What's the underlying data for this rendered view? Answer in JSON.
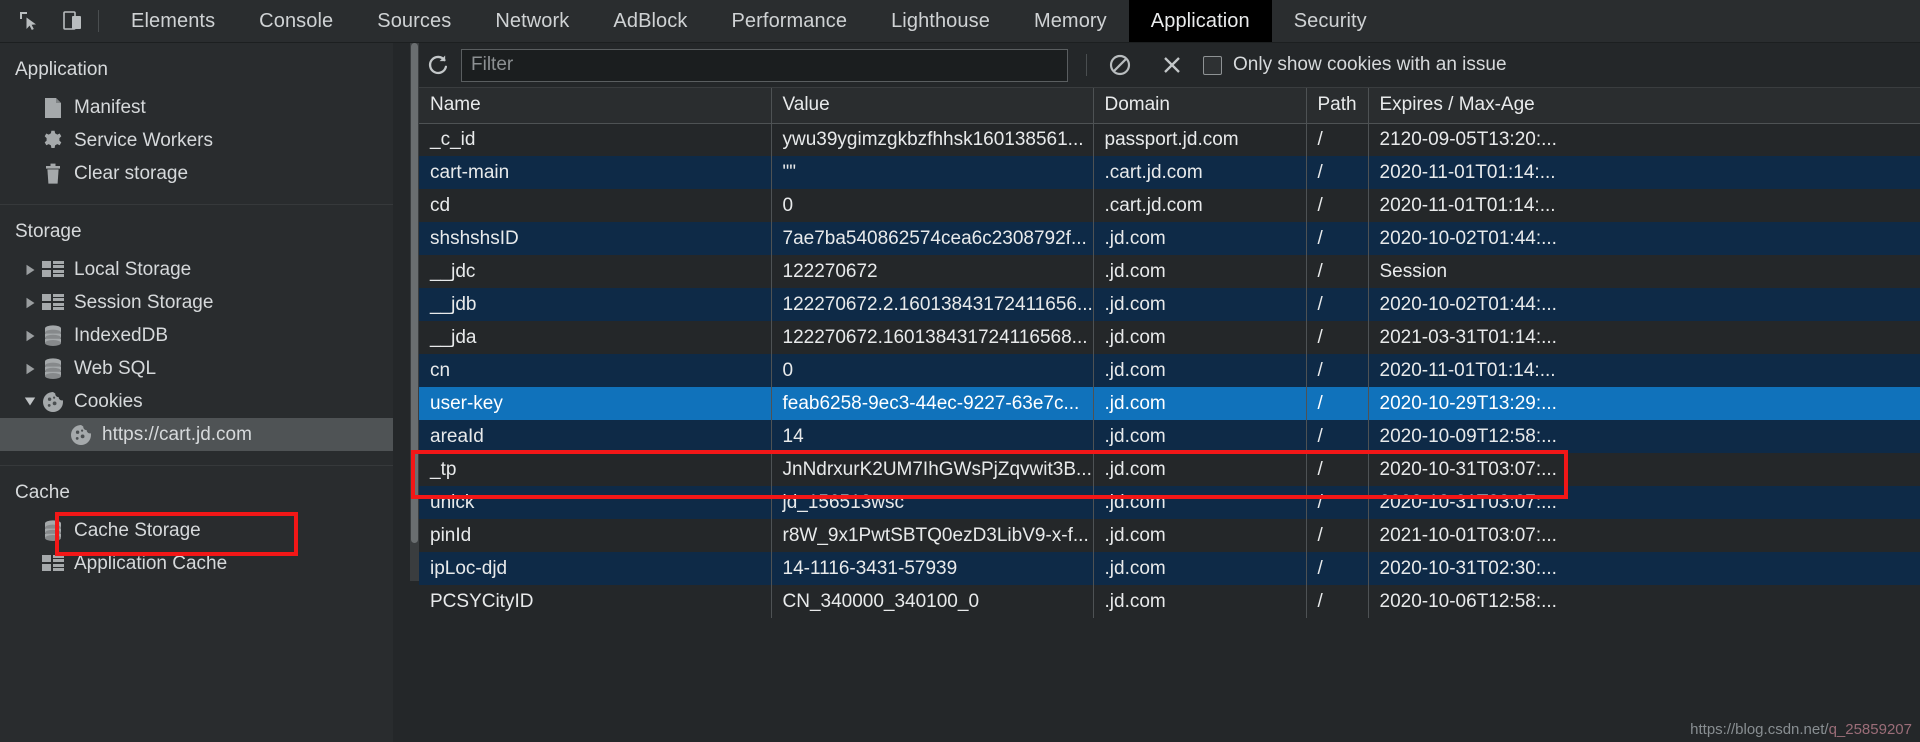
{
  "toolbar": {
    "icons": [
      {
        "name": "inspect-element-icon",
        "title": "Inspect element"
      },
      {
        "name": "device-toolbar-icon",
        "title": "Toggle device toolbar"
      }
    ],
    "tabs": [
      {
        "label": "Elements",
        "active": false
      },
      {
        "label": "Console",
        "active": false
      },
      {
        "label": "Sources",
        "active": false
      },
      {
        "label": "Network",
        "active": false
      },
      {
        "label": "AdBlock",
        "active": false
      },
      {
        "label": "Performance",
        "active": false
      },
      {
        "label": "Lighthouse",
        "active": false
      },
      {
        "label": "Memory",
        "active": false
      },
      {
        "label": "Application",
        "active": true
      },
      {
        "label": "Security",
        "active": false
      }
    ]
  },
  "sidebar": {
    "sections": [
      {
        "title": "Application",
        "items": [
          {
            "label": "Manifest",
            "icon": "document-icon",
            "twisty": "none",
            "selected": false
          },
          {
            "label": "Service Workers",
            "icon": "gear-icon",
            "twisty": "none",
            "selected": false
          },
          {
            "label": "Clear storage",
            "icon": "trash-icon",
            "twisty": "none",
            "selected": false
          }
        ]
      },
      {
        "title": "Storage",
        "items": [
          {
            "label": "Local Storage",
            "icon": "table-icon",
            "twisty": "collapsed",
            "selected": false
          },
          {
            "label": "Session Storage",
            "icon": "table-icon",
            "twisty": "collapsed",
            "selected": false
          },
          {
            "label": "IndexedDB",
            "icon": "database-icon",
            "twisty": "collapsed",
            "selected": false
          },
          {
            "label": "Web SQL",
            "icon": "database-icon",
            "twisty": "collapsed",
            "selected": false
          },
          {
            "label": "Cookies",
            "icon": "cookie-icon",
            "twisty": "expanded",
            "selected": false
          },
          {
            "label": "https://cart.jd.com",
            "icon": "cookie-icon",
            "twisty": "none",
            "selected": true,
            "child": true
          }
        ]
      },
      {
        "title": "Cache",
        "items": [
          {
            "label": "Cache Storage",
            "icon": "database-icon",
            "twisty": "none",
            "selected": false
          },
          {
            "label": "Application Cache",
            "icon": "table-icon",
            "twisty": "none",
            "selected": false
          }
        ]
      }
    ]
  },
  "cookie_toolbar": {
    "refresh_icon": "refresh-icon",
    "filter_placeholder": "Filter",
    "filter_value": "",
    "clear_icon": "clear-all-cookies-icon",
    "delete_icon": "delete-selected-cookie-icon",
    "issue_checkbox_label": "Only show cookies with an issue",
    "issue_checkbox_checked": false
  },
  "table": {
    "columns": [
      "Name",
      "Value",
      "Domain",
      "Path",
      "Expires / Max-Age"
    ],
    "rows": [
      {
        "name": "_c_id",
        "value": "ywu39ygimzgkbzfhhsk160138561...",
        "domain": "passport.jd.com",
        "path": "/",
        "expires": "2120-09-05T13:20:...",
        "selected": false
      },
      {
        "name": "cart-main",
        "value": "\"\"",
        "domain": ".cart.jd.com",
        "path": "/",
        "expires": "2020-11-01T01:14:...",
        "selected": false
      },
      {
        "name": "cd",
        "value": "0",
        "domain": ".cart.jd.com",
        "path": "/",
        "expires": "2020-11-01T01:14:...",
        "selected": false
      },
      {
        "name": "shshshsID",
        "value": "7ae7ba540862574cea6c2308792f...",
        "domain": ".jd.com",
        "path": "/",
        "expires": "2020-10-02T01:44:...",
        "selected": false
      },
      {
        "name": "__jdc",
        "value": "122270672",
        "domain": ".jd.com",
        "path": "/",
        "expires": "Session",
        "selected": false
      },
      {
        "name": "__jdb",
        "value": "122270672.2.16013843172411656...",
        "domain": ".jd.com",
        "path": "/",
        "expires": "2020-10-02T01:44:...",
        "selected": false
      },
      {
        "name": "__jda",
        "value": "122270672.160138431724116568...",
        "domain": ".jd.com",
        "path": "/",
        "expires": "2021-03-31T01:14:...",
        "selected": false
      },
      {
        "name": "cn",
        "value": "0",
        "domain": ".jd.com",
        "path": "/",
        "expires": "2020-11-01T01:14:...",
        "selected": false
      },
      {
        "name": "user-key",
        "value": "feab6258-9ec3-44ec-9227-63e7c...",
        "domain": ".jd.com",
        "path": "/",
        "expires": "2020-10-29T13:29:...",
        "selected": true
      },
      {
        "name": "areaId",
        "value": "14",
        "domain": ".jd.com",
        "path": "/",
        "expires": "2020-10-09T12:58:...",
        "selected": false
      },
      {
        "name": "_tp",
        "value": "JnNdrxurK2UM7IhGWsPjZqvwit3B...",
        "domain": ".jd.com",
        "path": "/",
        "expires": "2020-10-31T03:07:...",
        "selected": false
      },
      {
        "name": "unick",
        "value": "jd_156513wsc",
        "domain": ".jd.com",
        "path": "/",
        "expires": "2020-10-31T03:07:...",
        "selected": false
      },
      {
        "name": "pinId",
        "value": "r8W_9x1PwtSBTQ0ezD3LibV9-x-f...",
        "domain": ".jd.com",
        "path": "/",
        "expires": "2021-10-01T03:07:...",
        "selected": false
      },
      {
        "name": "ipLoc-djd",
        "value": "14-1116-3431-57939",
        "domain": ".jd.com",
        "path": "/",
        "expires": "2020-10-31T02:30:...",
        "selected": false
      },
      {
        "name": "PCSYCityID",
        "value": "CN_340000_340100_0",
        "domain": ".jd.com",
        "path": "/",
        "expires": "2020-10-06T12:58:...",
        "selected": false
      }
    ]
  },
  "annotations": [
    {
      "name": "cookie-origin-highlight",
      "color": "#f21717"
    },
    {
      "name": "user-key-row-highlight",
      "color": "#f21717"
    }
  ],
  "watermark": {
    "line1": "https://blog.csdn.net/",
    "line2": "q_25859207"
  }
}
